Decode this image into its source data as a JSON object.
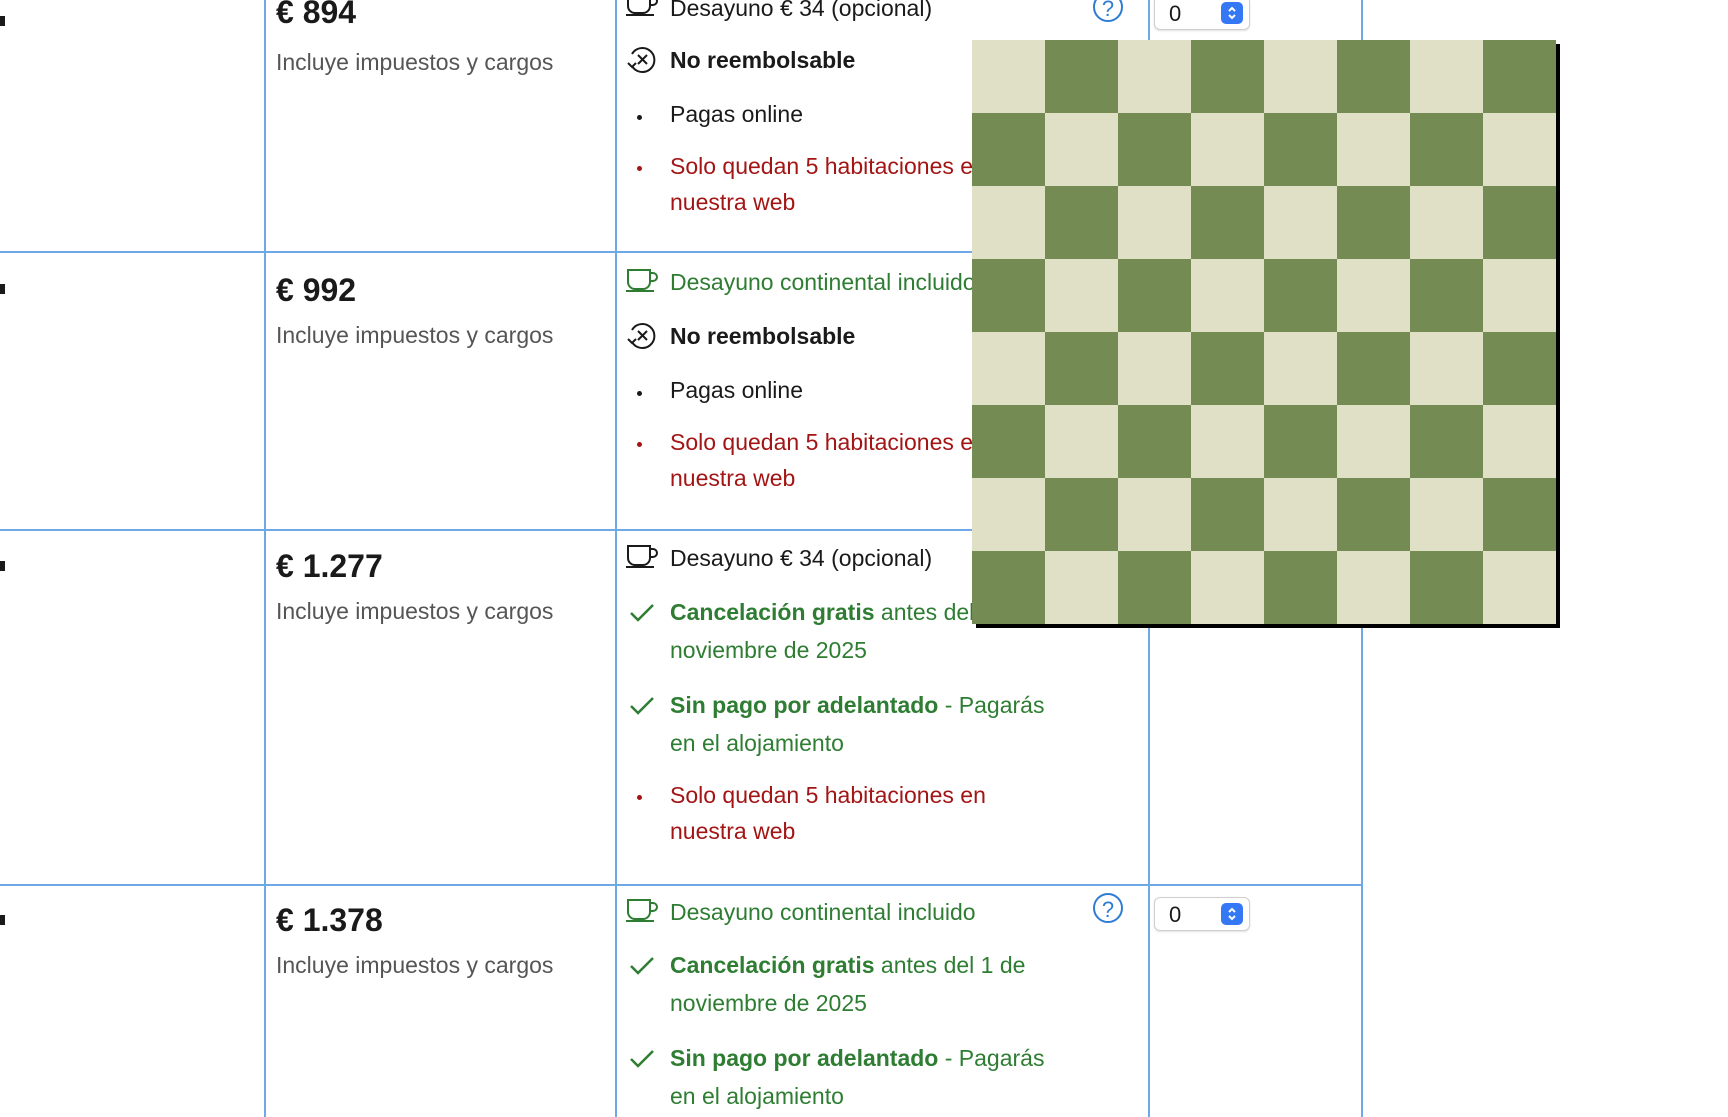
{
  "rows": [
    {
      "price": "€ 894",
      "taxes": "Incluye impuestos y cargos",
      "breakfast": {
        "text": "Desayuno € 34 (opcional)",
        "icon": "coffee-cup-icon"
      },
      "policy": {
        "bold": "No reembolsable",
        "icon": "no-refund-icon"
      },
      "payment": "Pagas online",
      "scarcity_line1": "Solo quedan 5 habitaciones en",
      "scarcity_line2": "nuestra web",
      "quantity": "0"
    },
    {
      "price": "€ 992",
      "taxes": "Incluye impuestos y cargos",
      "breakfast": {
        "text": "Desayuno continental incluido",
        "icon": "coffee-cup-icon"
      },
      "policy": {
        "bold": "No reembolsable",
        "icon": "no-refund-icon"
      },
      "payment": "Pagas online",
      "scarcity_line1": "Solo quedan 5 habitaciones en",
      "scarcity_line2": "nuestra web"
    },
    {
      "price": "€ 1.277",
      "taxes": "Incluye impuestos y cargos",
      "breakfast": {
        "text": "Desayuno € 34 (opcional)",
        "icon": "coffee-cup-icon"
      },
      "cancel_bold": "Cancelación gratis",
      "cancel_rest_line1": "antes del 1 de",
      "cancel_line2": "noviembre de 2025",
      "prepay_bold": "Sin pago por adelantado",
      "prepay_rest": "- Pagarás",
      "prepay_line2": "en el alojamiento",
      "scarcity_line1": "Solo quedan 5 habitaciones en",
      "scarcity_line2": "nuestra web"
    },
    {
      "price": "€ 1.378",
      "taxes": "Incluye impuestos y cargos",
      "breakfast": {
        "text": "Desayuno continental incluido",
        "icon": "coffee-cup-icon"
      },
      "cancel_bold": "Cancelación gratis",
      "cancel_rest_line1": "antes del 1 de",
      "cancel_line2": "noviembre de 2025",
      "prepay_bold": "Sin pago por adelantado",
      "prepay_rest": "- Pagarás",
      "prepay_line2": "en el alojamiento",
      "quantity": "0"
    }
  ],
  "help_symbol": "?",
  "colors": {
    "grid_line": "#6fa8e6",
    "green_text": "#2e7d32",
    "red_text": "#a31515",
    "board_light": "#e0e0c6",
    "board_dark": "#748c54",
    "select_accent": "#3478f6"
  },
  "chessboard": {
    "size": 8,
    "first_square": "light"
  }
}
